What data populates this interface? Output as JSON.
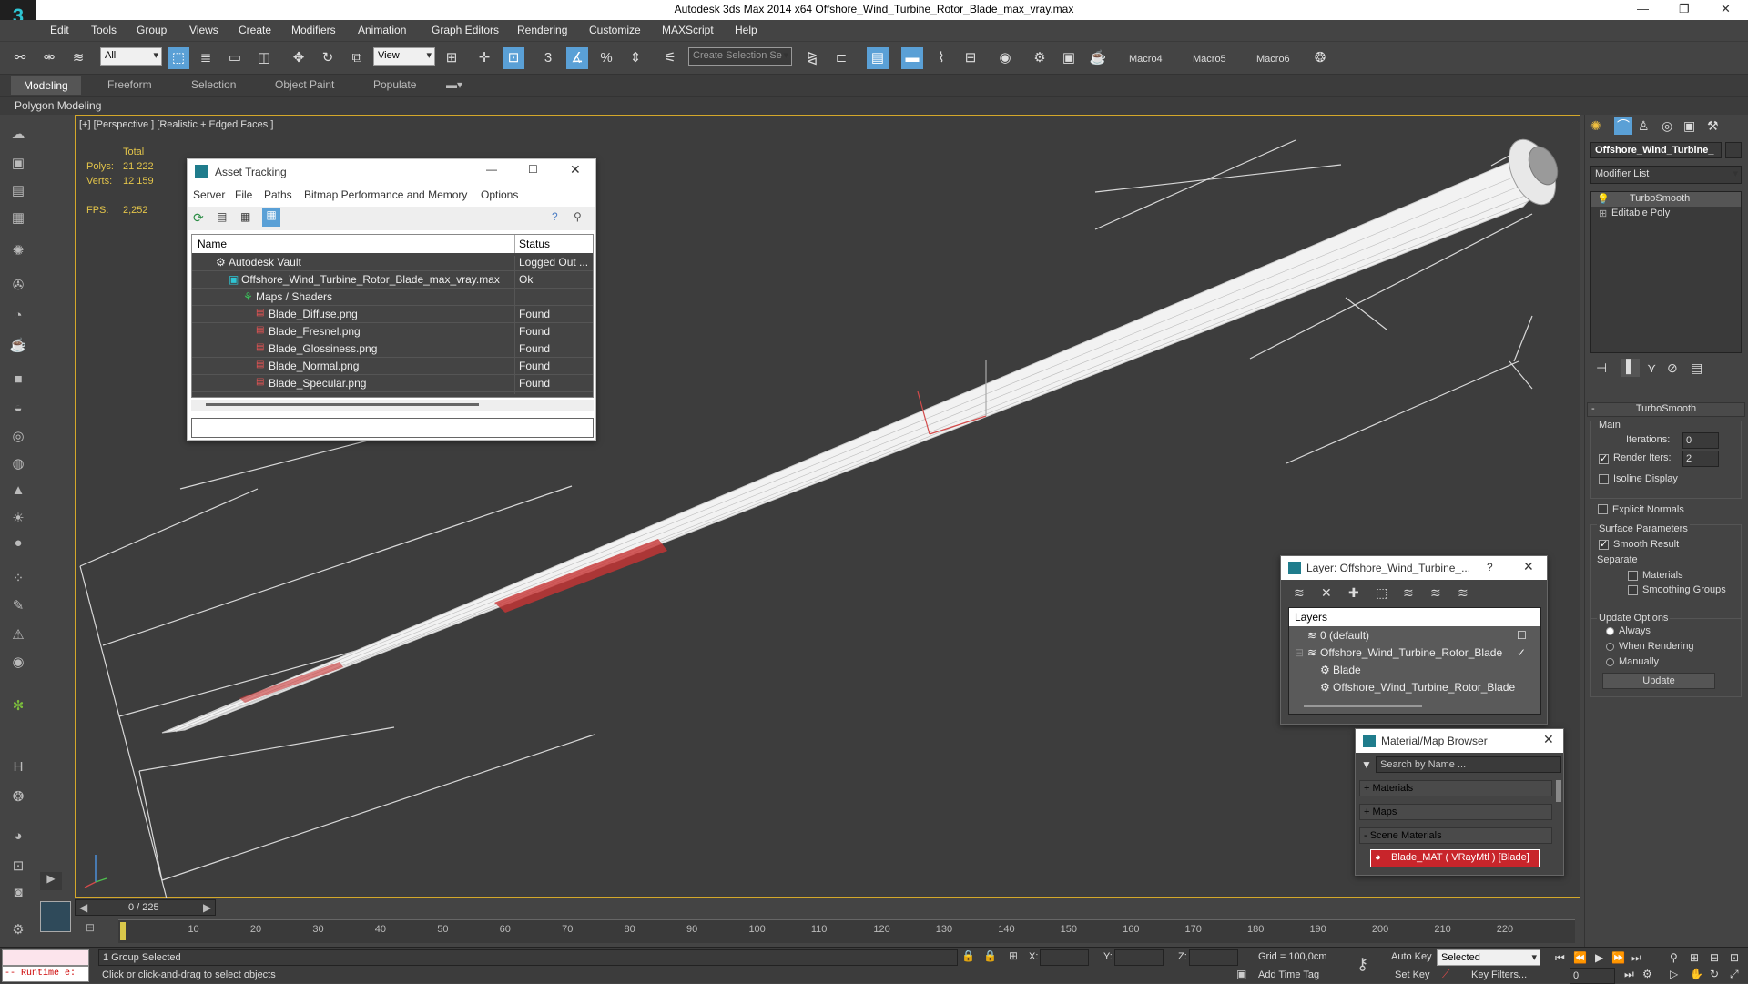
{
  "window": {
    "title": "Autodesk 3ds Max  2014 x64      Offshore_Wind_Turbine_Rotor_Blade_max_vray.max",
    "logo": "3"
  },
  "menu": [
    "Edit",
    "Tools",
    "Group",
    "Views",
    "Create",
    "Modifiers",
    "Animation",
    "Graph Editors",
    "Rendering",
    "Customize",
    "MAXScript",
    "Help"
  ],
  "toolbar": {
    "selection_filter": "All",
    "ref_coord": "View",
    "named_selection_placeholder": "Create Selection Se",
    "snap_label": "3",
    "angle_label": "%",
    "macros": [
      "Macro4",
      "Macro5",
      "Macro6"
    ]
  },
  "ribbon": {
    "tabs": [
      "Modeling",
      "Freeform",
      "Selection",
      "Object Paint",
      "Populate"
    ],
    "active": "Modeling",
    "panel": "Polygon Modeling"
  },
  "viewport": {
    "label": "[+] [Perspective ] [Realistic + Edged Faces ]",
    "stats": {
      "total_label": "Total",
      "polys_label": "Polys:",
      "polys": "21 222",
      "verts_label": "Verts:",
      "verts": "12 159",
      "fps_label": "FPS:",
      "fps": "2,252"
    }
  },
  "asset_tracking": {
    "title": "Asset Tracking",
    "menu": [
      "Server",
      "File",
      "Paths",
      "Bitmap Performance and Memory",
      "Options"
    ],
    "col_name": "Name",
    "col_status": "Status",
    "rows": [
      {
        "name": "Autodesk Vault",
        "status": "Logged Out ..."
      },
      {
        "name": "Offshore_Wind_Turbine_Rotor_Blade_max_vray.max",
        "status": "Ok"
      },
      {
        "name": "Maps / Shaders",
        "status": ""
      },
      {
        "name": "Blade_Diffuse.png",
        "status": "Found"
      },
      {
        "name": "Blade_Fresnel.png",
        "status": "Found"
      },
      {
        "name": "Blade_Glossiness.png",
        "status": "Found"
      },
      {
        "name": "Blade_Normal.png",
        "status": "Found"
      },
      {
        "name": "Blade_Specular.png",
        "status": "Found"
      }
    ]
  },
  "layer_dialog": {
    "title": "Layer: Offshore_Wind_Turbine_...",
    "help": "?",
    "header": "Layers",
    "rows": [
      "0 (default)",
      "Offshore_Wind_Turbine_Rotor_Blade",
      "Blade",
      "Offshore_Wind_Turbine_Rotor_Blade"
    ]
  },
  "mat_browser": {
    "title": "Material/Map Browser",
    "search_placeholder": "Search by Name ...",
    "groups": [
      "+ Materials",
      "+ Maps",
      "- Scene Materials"
    ],
    "selected_material": "Blade_MAT  ( VRayMtl )  [Blade]"
  },
  "command_panel": {
    "object_name": "Offshore_Wind_Turbine_",
    "modifier_list": "Modifier List",
    "stack": [
      "TurboSmooth",
      "Editable Poly"
    ],
    "rollout_title": "TurboSmooth",
    "main_label": "Main",
    "iterations_label": "Iterations:",
    "iterations": "0",
    "render_iters_label": "Render Iters:",
    "render_iters": "2",
    "isoline": "Isoline Display",
    "explicit_normals": "Explicit Normals",
    "surface_params": "Surface Parameters",
    "smooth_result": "Smooth Result",
    "separate": "Separate",
    "materials": "Materials",
    "smoothing_groups": "Smoothing Groups",
    "update_options": "Update Options",
    "always": "Always",
    "when_rendering": "When Rendering",
    "manually": "Manually",
    "update_btn": "Update"
  },
  "timeline": {
    "frame": "0 / 225",
    "ticks": [
      "10",
      "20",
      "30",
      "40",
      "50",
      "60",
      "70",
      "80",
      "90",
      "100",
      "110",
      "120",
      "130",
      "140",
      "150",
      "160",
      "170",
      "180",
      "190",
      "200",
      "210",
      "220"
    ]
  },
  "status": {
    "maxscript": "-- Runtime e:",
    "selected": "1 Group Selected",
    "prompt": "Click or click-and-drag to select objects",
    "x_label": "X:",
    "y_label": "Y:",
    "z_label": "Z:",
    "grid": "Grid = 100,0cm",
    "add_time_tag": "Add Time Tag",
    "auto_key": "Auto Key",
    "set_key": "Set Key",
    "selected_dd": "Selected",
    "key_filters": "Key Filters...",
    "frame": "0"
  }
}
